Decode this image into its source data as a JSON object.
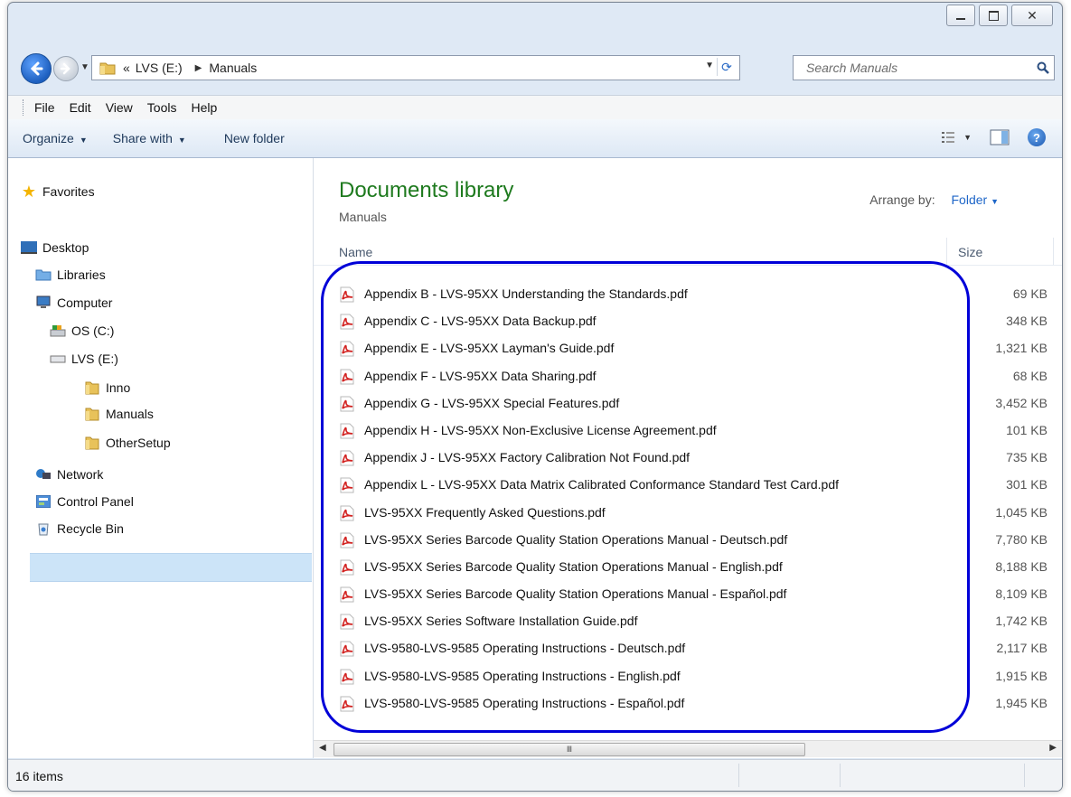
{
  "address": {
    "chevrons": "«",
    "crumbs": [
      "LVS (E:)",
      "Manuals"
    ]
  },
  "search": {
    "placeholder": "Search Manuals"
  },
  "menu": [
    "File",
    "Edit",
    "View",
    "Tools",
    "Help"
  ],
  "commands": {
    "organize": "Organize",
    "share": "Share with",
    "new_folder": "New folder"
  },
  "nav": {
    "favorites": "Favorites",
    "desktop": "Desktop",
    "libraries": "Libraries",
    "computer": "Computer",
    "os": "OS (C:)",
    "lvs": "LVS (E:)",
    "inno": "Inno",
    "manuals": "Manuals",
    "othersetup": "OtherSetup",
    "network": "Network",
    "control_panel": "Control Panel",
    "recycle_bin": "Recycle Bin"
  },
  "library": {
    "title": "Documents library",
    "subtitle": "Manuals",
    "arrange_label": "Arrange by:",
    "arrange_value": "Folder"
  },
  "columns": {
    "name": "Name",
    "size": "Size"
  },
  "files": [
    {
      "name": "Appendix B - LVS-95XX Understanding the Standards.pdf",
      "size": "69 KB"
    },
    {
      "name": "Appendix C - LVS-95XX Data Backup.pdf",
      "size": "348 KB"
    },
    {
      "name": "Appendix E - LVS-95XX Layman's Guide.pdf",
      "size": "1,321 KB"
    },
    {
      "name": "Appendix F - LVS-95XX Data Sharing.pdf",
      "size": "68 KB"
    },
    {
      "name": "Appendix G - LVS-95XX Special Features.pdf",
      "size": "3,452 KB"
    },
    {
      "name": "Appendix H - LVS-95XX Non-Exclusive License Agreement.pdf",
      "size": "101 KB"
    },
    {
      "name": "Appendix J - LVS-95XX Factory Calibration Not Found.pdf",
      "size": "735 KB"
    },
    {
      "name": "Appendix L - LVS-95XX Data Matrix Calibrated Conformance Standard Test Card.pdf",
      "size": "301 KB"
    },
    {
      "name": "LVS-95XX Frequently Asked Questions.pdf",
      "size": "1,045 KB"
    },
    {
      "name": "LVS-95XX Series Barcode Quality Station Operations Manual - Deutsch.pdf",
      "size": "7,780 KB"
    },
    {
      "name": "LVS-95XX Series Barcode Quality Station Operations Manual - English.pdf",
      "size": "8,188 KB"
    },
    {
      "name": "LVS-95XX Series Barcode Quality Station Operations Manual - Español.pdf",
      "size": "8,109 KB"
    },
    {
      "name": "LVS-95XX Series Software Installation Guide.pdf",
      "size": "1,742 KB"
    },
    {
      "name": "LVS-9580-LVS-9585 Operating Instructions - Deutsch.pdf",
      "size": "2,117 KB"
    },
    {
      "name": "LVS-9580-LVS-9585 Operating Instructions - English.pdf",
      "size": "1,915 KB"
    },
    {
      "name": "LVS-9580-LVS-9585 Operating Instructions - Español.pdf",
      "size": "1,945 KB"
    }
  ],
  "status": {
    "count": "16 items"
  },
  "colors": {
    "highlight": "#0000d8",
    "library_title": "#1e7a1e",
    "selection": "#cce4f8"
  }
}
